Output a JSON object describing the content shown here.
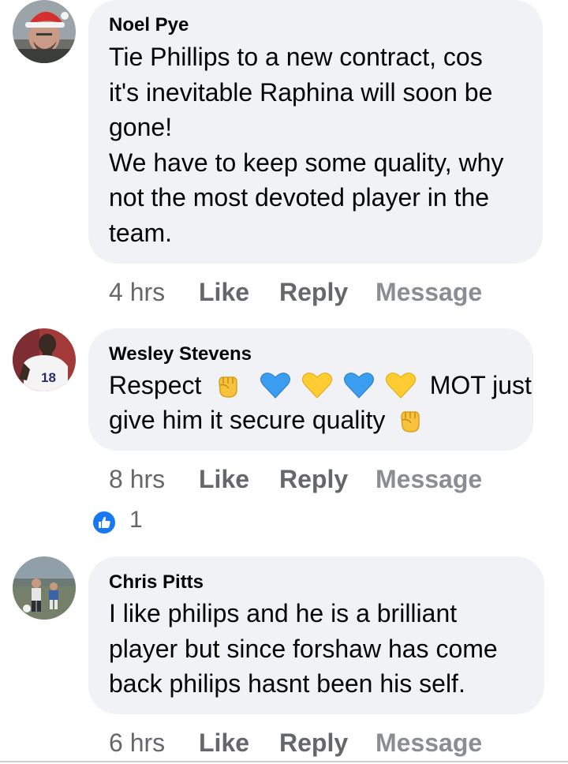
{
  "comments": [
    {
      "author": "Noel Pye",
      "lines": [
        "Tie Phillips to a new contract, cos",
        "it's inevitable Raphina will soon be",
        "gone!",
        "We have to keep some quality, why",
        "not the most devoted player in the",
        "team."
      ],
      "time": "4 hrs",
      "like_label": "Like",
      "reply_label": "Reply",
      "message_label": "Message"
    },
    {
      "author": "Wesley Stevens",
      "line1_start": "Respect",
      "line1_end": "MOT just",
      "line2": "give him it secure quality",
      "emoji_line1": [
        "raised-fist",
        "blue-heart",
        "yellow-heart",
        "blue-heart",
        "yellow-heart"
      ],
      "emoji_line2": [
        "raised-fist"
      ],
      "jersey_number": "18",
      "time": "8 hrs",
      "like_label": "Like",
      "reply_label": "Reply",
      "message_label": "Message",
      "reaction_count": "1"
    },
    {
      "author": "Chris Pitts",
      "lines": [
        "I like philips and he is a brilliant",
        "player but since forshaw has come",
        "back philips hasnt been his self."
      ],
      "time": "6 hrs",
      "like_label": "Like",
      "reply_label": "Reply",
      "message_label": "Message"
    }
  ],
  "colors": {
    "bubble": "#f0f2f5",
    "text": "#050505",
    "meta": "#65676b",
    "message": "#8a8d91",
    "like_blue": "#1877f2",
    "blue_heart": "#3b9df0",
    "yellow_heart": "#ffcc33",
    "fist": "#f7c23c"
  }
}
